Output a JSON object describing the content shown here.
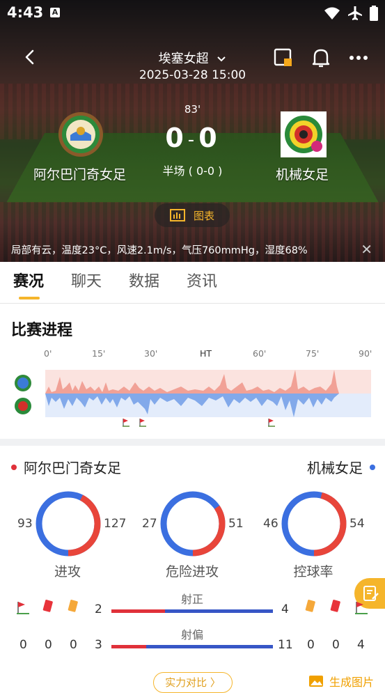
{
  "status_bar": {
    "time": "4:43",
    "notif_icon": "A"
  },
  "header": {
    "league": "埃塞女超",
    "datetime": "2025-03-28 15:00",
    "minute": "83'",
    "score_home": "0",
    "score_sep": "-",
    "score_away": "0",
    "half_time": "半场 ( 0-0 )",
    "home_team": "阿尔巴门奇女足",
    "away_team": "机械女足",
    "chart_button": "图表",
    "weather": "局部有云，温度23°C，风速2.1m/s，气压760mmHg，湿度68%"
  },
  "tabs": [
    {
      "label": "赛况"
    },
    {
      "label": "聊天"
    },
    {
      "label": "数据"
    },
    {
      "label": "资讯"
    }
  ],
  "progress": {
    "title": "比赛进程",
    "ticks": [
      "0'",
      "15'",
      "30'",
      "HT",
      "60'",
      "75'",
      "90'"
    ]
  },
  "stats": {
    "home_name": "阿尔巴门奇女足",
    "away_name": "机械女足",
    "rings": [
      {
        "label": "进攻",
        "home": "93",
        "away": "127"
      },
      {
        "label": "危险进攻",
        "home": "27",
        "away": "51"
      },
      {
        "label": "控球率",
        "home": "46",
        "away": "54"
      }
    ],
    "cards_row": {
      "home_shots_on": "2",
      "away_shots_on": "4",
      "label": "射正"
    },
    "off_row": {
      "label": "射偏",
      "home_corners": "0",
      "home_red": "0",
      "home_yellow": "0",
      "home_value": "3",
      "away_value": "11",
      "away_yellow": "0",
      "away_red": "0",
      "away_corners": "4"
    }
  },
  "footer": {
    "compare_button": "实力对比 〉",
    "generate_image": "生成图片"
  },
  "colors": {
    "home": "#e0313a",
    "away": "#3b6fe0",
    "accent": "#f5b52b"
  }
}
